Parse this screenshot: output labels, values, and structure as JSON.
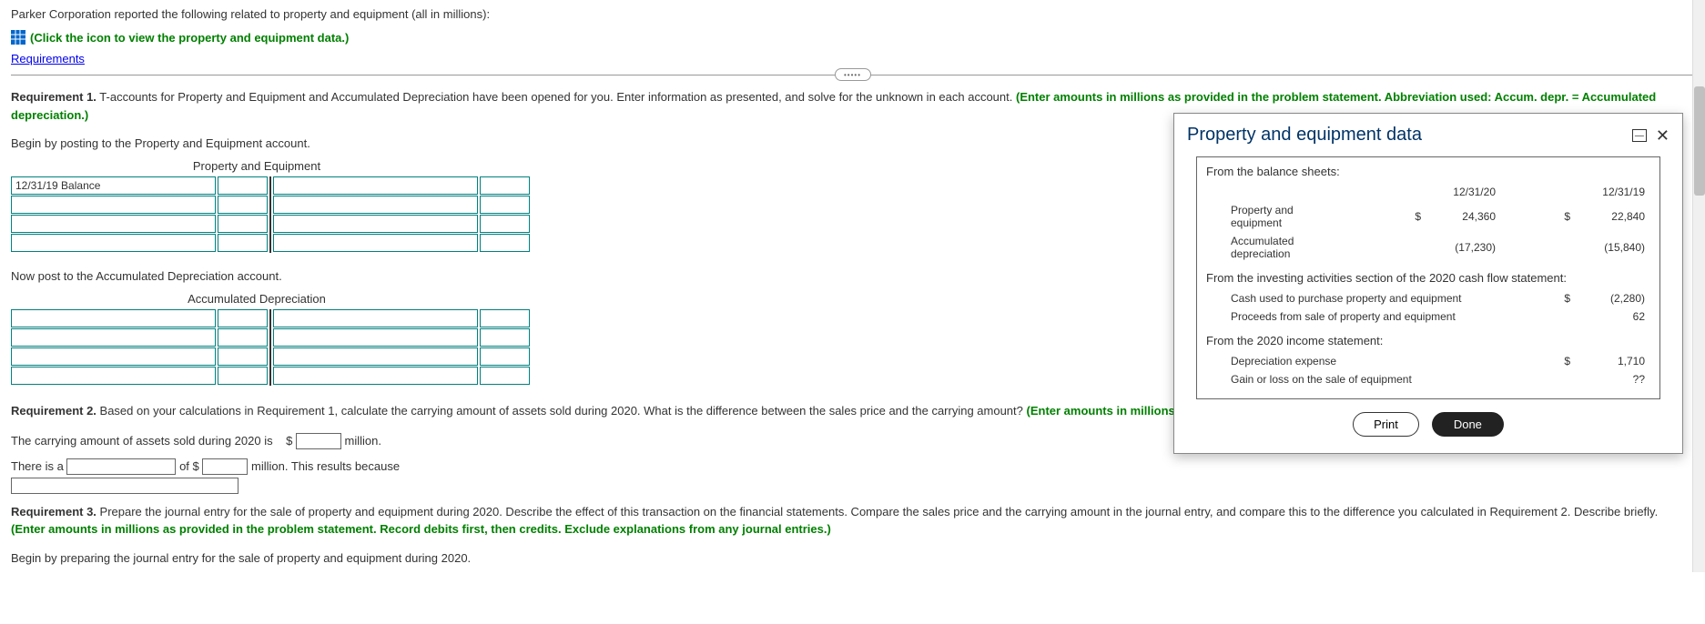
{
  "intro": "Parker Corporation reported the following related to property and equipment (all in millions):",
  "icon_link": "(Click the icon to view the property and equipment data.)",
  "requirements_link": "Requirements",
  "req1": {
    "label": "Requirement 1.",
    "text": " T-accounts for Property and Equipment and Accumulated Depreciation have been opened for you. Enter information as presented, and solve for the unknown in each account. ",
    "hint": "(Enter amounts in millions as provided in the problem statement. Abbreviation used: Accum. depr. = Accumulated depreciation.)"
  },
  "begin_post_pe": "Begin by posting to the Property and Equipment account.",
  "pe_title": "Property and Equipment",
  "pe_first_cell": "12/31/19 Balance",
  "now_post_ad": "Now post to the Accumulated Depreciation account.",
  "ad_title": "Accumulated Depreciation",
  "req2": {
    "label": "Requirement 2.",
    "text": " Based on your calculations in Requirement 1, calculate the carrying amount of assets sold during 2020. What is the difference between the sales price and the carrying amount? ",
    "hint": "(Enter amounts in millions a"
  },
  "carrying_sentence_pre": "The carrying amount of assets sold during 2020 is",
  "carrying_sentence_post": "million.",
  "there_is_pre": "There is a",
  "there_is_mid": "of $",
  "there_is_post": "million. This results because",
  "req3": {
    "label": "Requirement 3.",
    "text": " Prepare the journal entry for the sale of property and equipment during 2020. Describe the effect of this transaction on the financial statements. Compare the sales price and the carrying amount in the journal entry, and compare this to the difference you calculated in Requirement 2. Describe briefly. ",
    "hint": "(Enter amounts in millions as provided in the problem statement. Record debits first, then credits. Exclude explanations from any journal entries.)"
  },
  "begin_journal": "Begin by preparing the journal entry for the sale of property and equipment during 2020.",
  "popup": {
    "title": "Property and equipment data",
    "balance_sheets": "From the balance sheets:",
    "col1": "12/31/20",
    "col2": "12/31/19",
    "row_pe": "Property and equipment",
    "row_pe_v1": "24,360",
    "row_pe_v2": "22,840",
    "row_ad": "Accumulated depreciation",
    "row_ad_v1": "(17,230)",
    "row_ad_v2": "(15,840)",
    "investing": "From the investing activities section of the 2020 cash flow statement:",
    "row_cash": "Cash used to purchase property and equipment",
    "row_cash_v": "(2,280)",
    "row_proceeds": "Proceeds from sale of property and equipment",
    "row_proceeds_v": "62",
    "income": "From the 2020 income statement:",
    "row_dep": "Depreciation expense",
    "row_dep_v": "1,710",
    "row_gain": "Gain or loss on the sale of equipment",
    "row_gain_v": "??",
    "print": "Print",
    "done": "Done"
  },
  "currency": "$"
}
